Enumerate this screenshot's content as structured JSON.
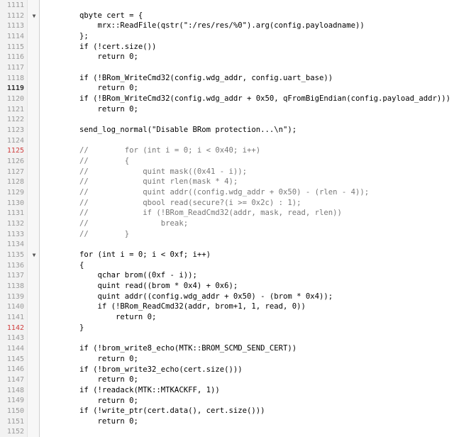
{
  "editor": {
    "fold_glyph": "▼",
    "lines": [
      {
        "n": "1111",
        "code": "",
        "fold": false
      },
      {
        "n": "1112",
        "code": "qbyte cert = {",
        "fold": true
      },
      {
        "n": "1113",
        "code": "    mrx::ReadFile(qstr(\":/res/res/%0\").arg(config.payloadname))",
        "fold": false
      },
      {
        "n": "1114",
        "code": "};",
        "fold": false
      },
      {
        "n": "1115",
        "code": "if (!cert.size())",
        "fold": false
      },
      {
        "n": "1116",
        "code": "    return 0;",
        "fold": false
      },
      {
        "n": "1117",
        "code": "",
        "fold": false
      },
      {
        "n": "1118",
        "code": "if (!BRom_WriteCmd32(config.wdg_addr, config.uart_base))",
        "fold": false
      },
      {
        "n": "1119",
        "code": "    return 0;",
        "fold": false,
        "current": true
      },
      {
        "n": "1120",
        "code": "if (!BRom_WriteCmd32(config.wdg_addr + 0x50, qFromBigEndian(config.payload_addr)))",
        "fold": false
      },
      {
        "n": "1121",
        "code": "    return 0;",
        "fold": false
      },
      {
        "n": "1122",
        "code": "",
        "fold": false
      },
      {
        "n": "1123",
        "code": "send_log_normal(\"Disable BRom protection...\\n\");",
        "fold": false
      },
      {
        "n": "1124",
        "code": "",
        "fold": false
      },
      {
        "n": "1125",
        "code": "//        for (int i = 0; i < 0x40; i++)",
        "fold": false,
        "comment": true,
        "mark": true
      },
      {
        "n": "1126",
        "code": "//        {",
        "fold": false,
        "comment": true
      },
      {
        "n": "1127",
        "code": "//            quint mask((0x41 - i));",
        "fold": false,
        "comment": true
      },
      {
        "n": "1128",
        "code": "//            quint rlen(mask * 4);",
        "fold": false,
        "comment": true
      },
      {
        "n": "1129",
        "code": "//            quint addr((config.wdg_addr + 0x50) - (rlen - 4));",
        "fold": false,
        "comment": true
      },
      {
        "n": "1130",
        "code": "//            qbool read(secure?(i >= 0x2c) : 1);",
        "fold": false,
        "comment": true
      },
      {
        "n": "1131",
        "code": "//            if (!BRom_ReadCmd32(addr, mask, read, rlen))",
        "fold": false,
        "comment": true
      },
      {
        "n": "1132",
        "code": "//                break;",
        "fold": false,
        "comment": true
      },
      {
        "n": "1133",
        "code": "//        }",
        "fold": false,
        "comment": true
      },
      {
        "n": "1134",
        "code": "",
        "fold": false
      },
      {
        "n": "1135",
        "code": "for (int i = 0; i < 0xf; i++)",
        "fold": true
      },
      {
        "n": "1136",
        "code": "{",
        "fold": false
      },
      {
        "n": "1137",
        "code": "    qchar brom((0xf - i));",
        "fold": false
      },
      {
        "n": "1138",
        "code": "    quint read((brom * 0x4) + 0x6);",
        "fold": false
      },
      {
        "n": "1139",
        "code": "    quint addr((config.wdg_addr + 0x50) - (brom * 0x4));",
        "fold": false
      },
      {
        "n": "1140",
        "code": "    if (!BRom_ReadCmd32(addr, brom+1, 1, read, 0))",
        "fold": false
      },
      {
        "n": "1141",
        "code": "        return 0;",
        "fold": false
      },
      {
        "n": "1142",
        "code": "}",
        "fold": false,
        "mark": true
      },
      {
        "n": "1143",
        "code": "",
        "fold": false
      },
      {
        "n": "1144",
        "code": "if (!brom_write8_echo(MTK::BROM_SCMD_SEND_CERT))",
        "fold": false
      },
      {
        "n": "1145",
        "code": "    return 0;",
        "fold": false
      },
      {
        "n": "1146",
        "code": "if (!brom_write32_echo(cert.size()))",
        "fold": false
      },
      {
        "n": "1147",
        "code": "    return 0;",
        "fold": false
      },
      {
        "n": "1148",
        "code": "if (!readack(MTK::MTKACKFF, 1))",
        "fold": false
      },
      {
        "n": "1149",
        "code": "    return 0;",
        "fold": false
      },
      {
        "n": "1150",
        "code": "if (!write_ptr(cert.data(), cert.size()))",
        "fold": false
      },
      {
        "n": "1151",
        "code": "    return 0;",
        "fold": false
      },
      {
        "n": "1152",
        "code": "",
        "fold": false
      }
    ]
  }
}
